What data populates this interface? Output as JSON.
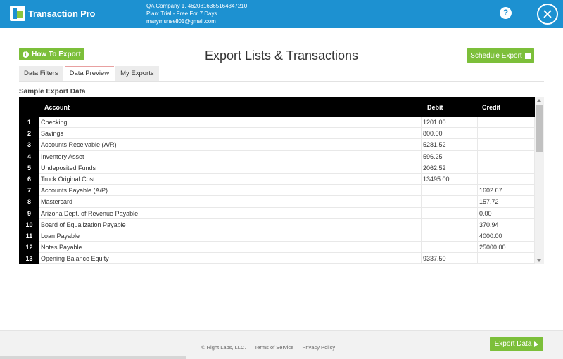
{
  "header": {
    "app_name": "Transaction Pro",
    "company_line": "QA Company 1, 4620816365164347210",
    "plan_line": "Plan: Trial - Free For 7 Days",
    "email": "marymunsell01@gmail.com",
    "help_glyph": "?"
  },
  "actions": {
    "how_to_label": "How To Export",
    "schedule_label": "Schedule Export",
    "export_data_label": "Export Data"
  },
  "page": {
    "title": "Export Lists & Transactions",
    "section_label": "Sample Export Data"
  },
  "tabs": [
    {
      "label": "Data Filters",
      "active": false
    },
    {
      "label": "Data Preview",
      "active": true
    },
    {
      "label": "My Exports",
      "active": false
    }
  ],
  "table": {
    "columns": [
      "Account",
      "Debit",
      "Credit"
    ],
    "rows": [
      {
        "num": "1",
        "account": "Checking",
        "debit": "1201.00",
        "credit": ""
      },
      {
        "num": "2",
        "account": "Savings",
        "debit": "800.00",
        "credit": ""
      },
      {
        "num": "3",
        "account": "Accounts Receivable (A/R)",
        "debit": "5281.52",
        "credit": ""
      },
      {
        "num": "4",
        "account": "Inventory Asset",
        "debit": "596.25",
        "credit": ""
      },
      {
        "num": "5",
        "account": "Undeposited Funds",
        "debit": "2062.52",
        "credit": ""
      },
      {
        "num": "6",
        "account": "Truck:Original Cost",
        "debit": "13495.00",
        "credit": ""
      },
      {
        "num": "7",
        "account": "Accounts Payable (A/P)",
        "debit": "",
        "credit": "1602.67"
      },
      {
        "num": "8",
        "account": "Mastercard",
        "debit": "",
        "credit": "157.72"
      },
      {
        "num": "9",
        "account": "Arizona Dept. of Revenue Payable",
        "debit": "",
        "credit": "0.00"
      },
      {
        "num": "10",
        "account": "Board of Equalization Payable",
        "debit": "",
        "credit": "370.94"
      },
      {
        "num": "11",
        "account": "Loan Payable",
        "debit": "",
        "credit": "4000.00"
      },
      {
        "num": "12",
        "account": "Notes Payable",
        "debit": "",
        "credit": "25000.00"
      },
      {
        "num": "13",
        "account": "Opening Balance Equity",
        "debit": "9337.50",
        "credit": ""
      }
    ]
  },
  "footer": {
    "copyright": "© Right Labs, LLC.",
    "terms": "Terms of Service",
    "privacy": "Privacy Policy"
  },
  "colors": {
    "header_blue": "#1d91d1",
    "button_green": "#7cbf3a"
  }
}
